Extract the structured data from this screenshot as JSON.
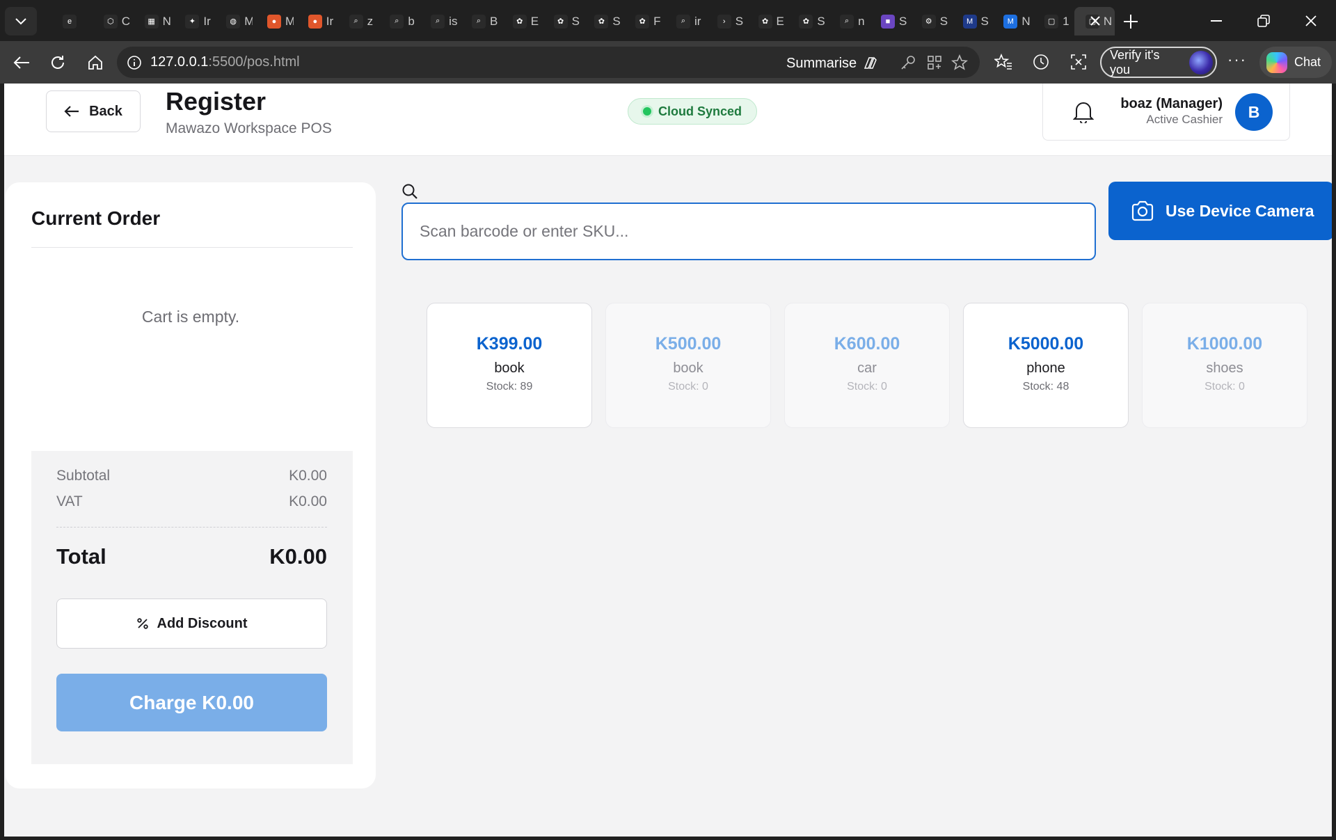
{
  "browser": {
    "tabs": [
      {
        "icon": "edx-icon",
        "label": "",
        "color": "#2a2a2a"
      },
      {
        "icon": "cube-icon",
        "label": "C",
        "color": "#2a2a2a"
      },
      {
        "icon": "calendar-icon",
        "label": "N",
        "color": "#2a2a2a"
      },
      {
        "icon": "gemini-icon",
        "label": "Ir",
        "color": "#2a2a2a"
      },
      {
        "icon": "globe-icon",
        "label": "M",
        "color": "#2a2a2a"
      },
      {
        "icon": "flame-icon",
        "label": "M",
        "color": "#e0562b"
      },
      {
        "icon": "flame-icon",
        "label": "Ir",
        "color": "#e0562b"
      },
      {
        "icon": "search-icon",
        "label": "z",
        "color": "#2a2a2a"
      },
      {
        "icon": "search-icon",
        "label": "b",
        "color": "#2a2a2a"
      },
      {
        "icon": "search-icon",
        "label": "is",
        "color": "#2a2a2a"
      },
      {
        "icon": "search-icon",
        "label": "B",
        "color": "#2a2a2a"
      },
      {
        "icon": "ai-studio-icon",
        "label": "E",
        "color": "#2a2a2a"
      },
      {
        "icon": "ai-studio-icon",
        "label": "S",
        "color": "#2a2a2a"
      },
      {
        "icon": "ai-studio-icon",
        "label": "S",
        "color": "#2a2a2a"
      },
      {
        "icon": "ai-studio-icon",
        "label": "F",
        "color": "#2a2a2a"
      },
      {
        "icon": "search-icon",
        "label": "ir",
        "color": "#2a2a2a"
      },
      {
        "icon": "chevron-right-icon",
        "label": "S",
        "color": "#2a2a2a"
      },
      {
        "icon": "ai-studio-icon",
        "label": "E",
        "color": "#2a2a2a"
      },
      {
        "icon": "ai-studio-icon",
        "label": "S",
        "color": "#2a2a2a"
      },
      {
        "icon": "search-icon",
        "label": "n",
        "color": "#2a2a2a"
      },
      {
        "icon": "app-icon",
        "label": "S",
        "color": "#6b46c1"
      },
      {
        "icon": "gear-icon",
        "label": "S",
        "color": "#2a2a2a"
      },
      {
        "icon": "m-icon",
        "label": "S",
        "color": "#1e3a8a"
      },
      {
        "icon": "m-icon",
        "label": "N",
        "color": "#1d6fe0"
      },
      {
        "icon": "page-icon",
        "label": "1",
        "color": "#2a2a2a"
      },
      {
        "icon": "page-icon",
        "label": "N",
        "color": "#2a2a2a"
      }
    ],
    "url_host": "127.0.0.1",
    "url_path": ":5500/pos.html",
    "summarise_label": "Summarise",
    "verify_label": "Verify it's you",
    "more_label": "···",
    "chat_label": "Chat"
  },
  "header": {
    "back_label": "Back",
    "title": "Register",
    "subtitle": "Mawazo Workspace POS",
    "sync_status": "Cloud Synced",
    "user_name": "boaz (Manager)",
    "user_role": "Active Cashier",
    "avatar_initial": "B"
  },
  "order": {
    "title": "Current Order",
    "empty_message": "Cart is empty.",
    "subtotal_label": "Subtotal",
    "subtotal_value": "K0.00",
    "vat_label": "VAT",
    "vat_value": "K0.00",
    "total_label": "Total",
    "total_value": "K0.00",
    "discount_label": "Add Discount",
    "charge_label": "Charge K0.00"
  },
  "search": {
    "placeholder": "Scan barcode or enter SKU...",
    "camera_label": "Use Device Camera"
  },
  "products": [
    {
      "price": "K399.00",
      "name": "book",
      "stock": "Stock: 89",
      "in_stock": true
    },
    {
      "price": "K500.00",
      "name": "book",
      "stock": "Stock: 0",
      "in_stock": false
    },
    {
      "price": "K600.00",
      "name": "car",
      "stock": "Stock: 0",
      "in_stock": false
    },
    {
      "price": "K5000.00",
      "name": "phone",
      "stock": "Stock: 48",
      "in_stock": true
    },
    {
      "price": "K1000.00",
      "name": "shoes",
      "stock": "Stock: 0",
      "in_stock": false
    }
  ],
  "colors": {
    "primary": "#0b63ce",
    "primary_disabled": "#7aaee8",
    "sync_green": "#22c55e"
  }
}
